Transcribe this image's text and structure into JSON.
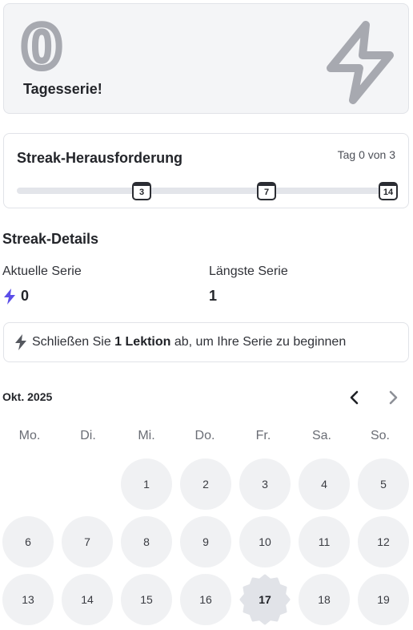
{
  "streak": {
    "count": "0",
    "label": "Tagesserie!",
    "icon": "lightning-bolt-icon"
  },
  "challenge": {
    "title": "Streak-Herausforderung",
    "day_text": "Tag 0 von 3",
    "progress_fraction": 0,
    "milestones": [
      "3",
      "7",
      "14"
    ]
  },
  "details": {
    "title": "Streak-Details",
    "current_label": "Aktuelle Serie",
    "current_value": "0",
    "longest_label": "Längste Serie",
    "longest_value": "1"
  },
  "banner": {
    "prefix": "Schließen Sie ",
    "bold": "1 Lektion",
    "suffix": " ab, um Ihre Serie zu beginnen"
  },
  "calendar": {
    "month": "Okt. 2025",
    "weekdays": [
      "Mo.",
      "Di.",
      "Mi.",
      "Do.",
      "Fr.",
      "Sa.",
      "So."
    ],
    "days": [
      "1",
      "2",
      "3",
      "4",
      "5",
      "6",
      "7",
      "8",
      "9",
      "10",
      "11",
      "12",
      "13",
      "14",
      "15",
      "16",
      "17",
      "18",
      "19"
    ],
    "today": "17"
  },
  "colors": {
    "accent": "#5b4ee8",
    "muted_icon": "#a7a9b0",
    "card_bg": "#f4f5f7"
  }
}
